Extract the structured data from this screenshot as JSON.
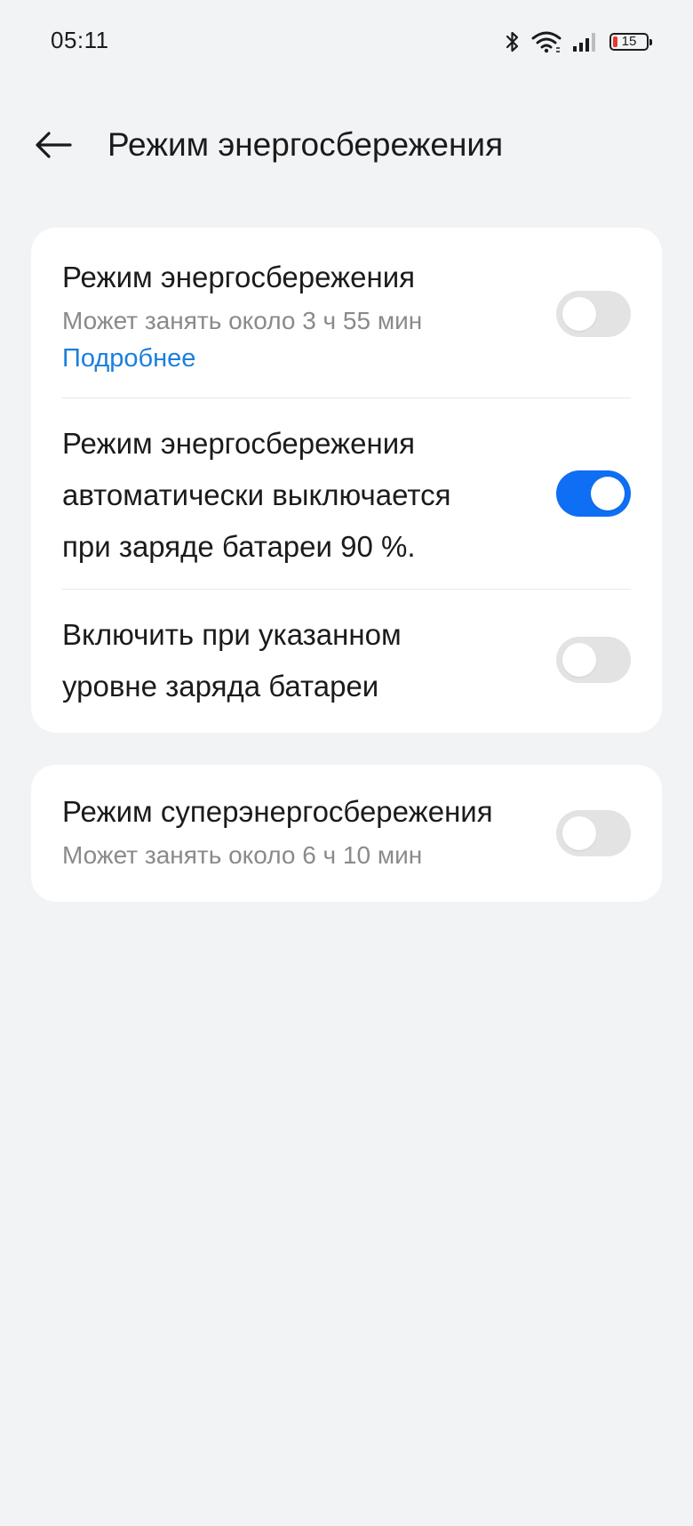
{
  "status_bar": {
    "time": "05:11",
    "battery_level": "15",
    "icons": [
      "bluetooth-icon",
      "wifi-icon",
      "signal-icon",
      "battery-icon"
    ]
  },
  "header": {
    "back_icon": "arrow-left-icon",
    "title": "Режим энергосбережения"
  },
  "settings": {
    "power_saving": {
      "title": "Режим энергосбережения",
      "subtitle": "Может занять около 3 ч 55 мин",
      "link": "Подробнее",
      "enabled": false
    },
    "auto_off": {
      "line1": "Режим энергосбережения",
      "line2": "автоматически выключается",
      "line3": "при заряде батареи 90 %.",
      "enabled": true
    },
    "enable_at_level": {
      "line1": "Включить при указанном",
      "line2": "уровне заряда батареи",
      "enabled": false
    },
    "super_power_saving": {
      "title": "Режим суперэнергосбережения",
      "subtitle": "Может занять около 6 ч 10 мин",
      "enabled": false
    }
  },
  "colors": {
    "background": "#f2f3f5",
    "card": "#ffffff",
    "accent": "#0e6ef4",
    "link": "#1a7fdc",
    "toggle_off": "#e3e3e3",
    "battery_low": "#e53935"
  }
}
